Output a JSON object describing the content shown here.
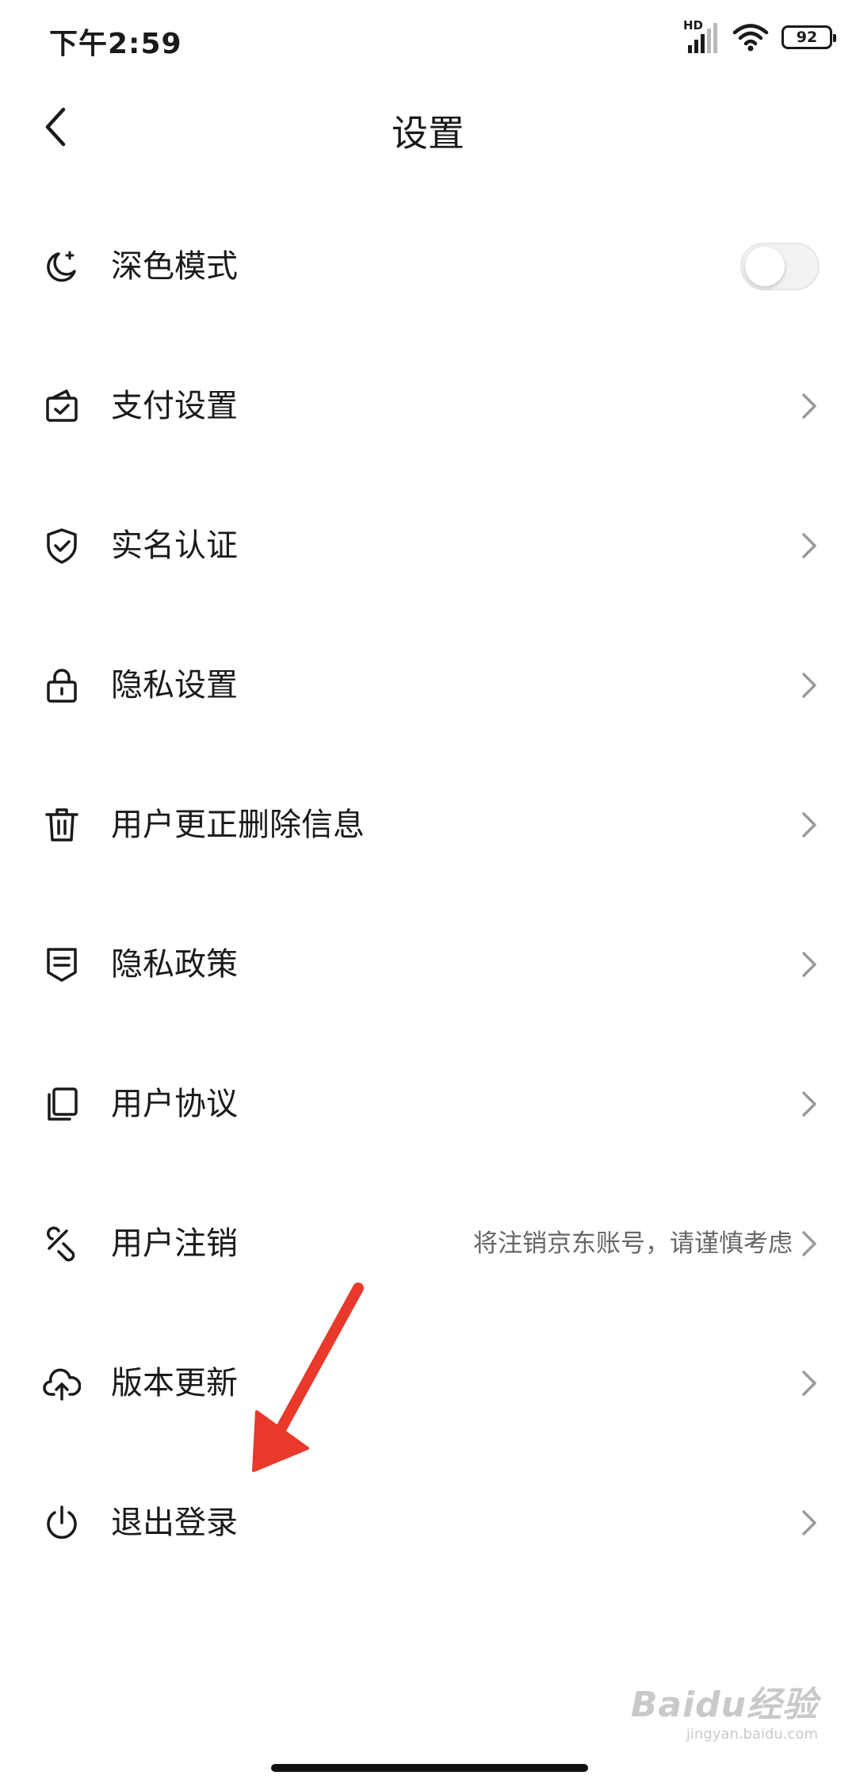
{
  "status_bar": {
    "time": "下午2:59",
    "network_label": "HD",
    "battery": "92"
  },
  "header": {
    "title": "设置"
  },
  "settings": {
    "items": [
      {
        "label": "深色模式",
        "icon": "moon-icon",
        "control": "toggle",
        "toggle_on": false
      },
      {
        "label": "支付设置",
        "icon": "wallet-icon",
        "control": "chevron"
      },
      {
        "label": "实名认证",
        "icon": "shield-check-icon",
        "control": "chevron"
      },
      {
        "label": "隐私设置",
        "icon": "lock-icon",
        "control": "chevron"
      },
      {
        "label": "用户更正删除信息",
        "icon": "trash-icon",
        "control": "chevron"
      },
      {
        "label": "隐私政策",
        "icon": "document-badge-icon",
        "control": "chevron"
      },
      {
        "label": "用户协议",
        "icon": "copy-document-icon",
        "control": "chevron"
      },
      {
        "label": "用户注销",
        "icon": "unlink-icon",
        "control": "chevron",
        "hint": "将注销京东账号，请谨慎考虑"
      },
      {
        "label": "版本更新",
        "icon": "cloud-upload-icon",
        "control": "chevron"
      },
      {
        "label": "退出登录",
        "icon": "power-icon",
        "control": "chevron"
      }
    ]
  },
  "annotation": {
    "arrow_color": "#e8392b"
  },
  "watermark": {
    "logo": "Baidu经验",
    "url": "jingyan.baidu.com"
  },
  "colors": {
    "text": "#1a1a1a",
    "hint": "#666666",
    "chevron": "#9a9a9a",
    "toggle_track": "#f2f2f2"
  }
}
